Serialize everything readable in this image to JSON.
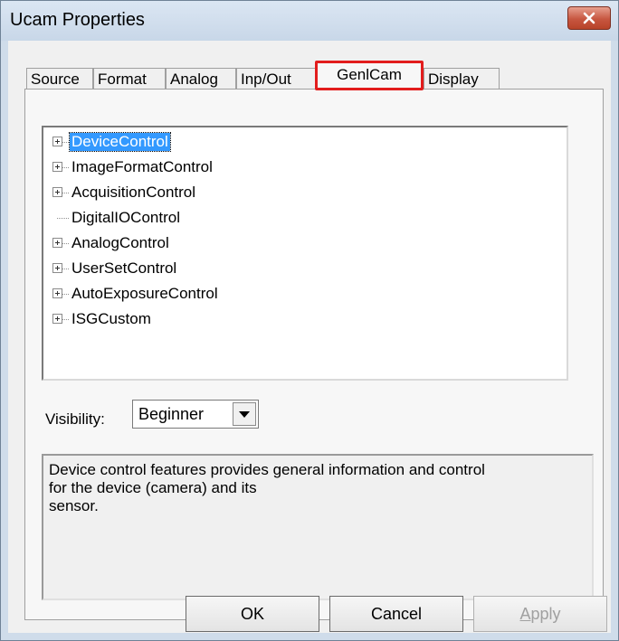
{
  "window": {
    "title": "Ucam Properties"
  },
  "tabs": [
    {
      "label": "Source"
    },
    {
      "label": "Format"
    },
    {
      "label": "Analog"
    },
    {
      "label": "Inp/Out"
    },
    {
      "label": "GenlCam",
      "active": true
    },
    {
      "label": "Display"
    }
  ],
  "tree": {
    "items": [
      {
        "label": "DeviceControl",
        "expandable": true,
        "selected": true
      },
      {
        "label": "ImageFormatControl",
        "expandable": true
      },
      {
        "label": "AcquisitionControl",
        "expandable": true
      },
      {
        "label": "DigitalIOControl",
        "expandable": false
      },
      {
        "label": "AnalogControl",
        "expandable": true
      },
      {
        "label": "UserSetControl",
        "expandable": true
      },
      {
        "label": "AutoExposureControl",
        "expandable": true
      },
      {
        "label": "ISGCustom",
        "expandable": true
      }
    ]
  },
  "visibility": {
    "label": "Visibility:",
    "value": "Beginner"
  },
  "description": "Device control features provides general information and control\nfor the device (camera) and its\nsensor.",
  "buttons": {
    "ok": "OK",
    "cancel": "Cancel",
    "apply": "Apply"
  },
  "colors": {
    "highlight": "#e21d1d",
    "selection": "#3399ff",
    "close": "#c75640"
  }
}
